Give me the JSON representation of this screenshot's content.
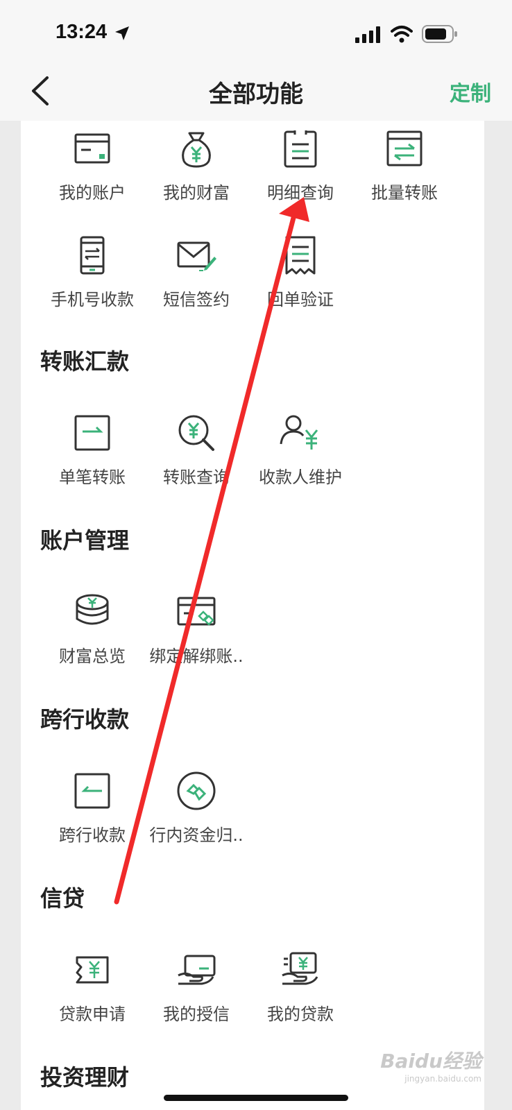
{
  "status_bar": {
    "time": "13:24"
  },
  "nav": {
    "title": "全部功能",
    "customize": "定制"
  },
  "colors": {
    "accent": "#3bb27a",
    "icon_stroke": "#333333",
    "annotation": "#f02a2a"
  },
  "quick_items": [
    {
      "label": "我的账户",
      "icon": "account-icon"
    },
    {
      "label": "我的财富",
      "icon": "money-bag-icon"
    },
    {
      "label": "明细查询",
      "icon": "statement-icon"
    },
    {
      "label": "批量转账",
      "icon": "batch-transfer-icon"
    },
    {
      "label": "手机号收款",
      "icon": "phone-receive-icon"
    },
    {
      "label": "短信签约",
      "icon": "sms-sign-icon"
    },
    {
      "label": "回单验证",
      "icon": "receipt-verify-icon"
    }
  ],
  "sections": [
    {
      "title": "转账汇款",
      "items": [
        {
          "label": "单笔转账",
          "icon": "single-transfer-icon"
        },
        {
          "label": "转账查询",
          "icon": "transfer-query-icon"
        },
        {
          "label": "收款人维护",
          "icon": "payee-icon"
        }
      ]
    },
    {
      "title": "账户管理",
      "items": [
        {
          "label": "财富总览",
          "icon": "wealth-overview-icon"
        },
        {
          "label": "绑定解绑账..",
          "icon": "bind-card-icon"
        }
      ]
    },
    {
      "title": "跨行收款",
      "items": [
        {
          "label": "跨行收款",
          "icon": "cross-bank-icon"
        },
        {
          "label": "行内资金归..",
          "icon": "fund-collect-icon"
        }
      ]
    },
    {
      "title": "信贷",
      "items": [
        {
          "label": "贷款申请",
          "icon": "loan-apply-icon"
        },
        {
          "label": "我的授信",
          "icon": "credit-icon"
        },
        {
          "label": "我的贷款",
          "icon": "my-loan-icon"
        }
      ]
    },
    {
      "title": "投资理财",
      "items": []
    }
  ],
  "watermark": {
    "brand": "Baidu经验",
    "url": "jingyan.baidu.com"
  }
}
